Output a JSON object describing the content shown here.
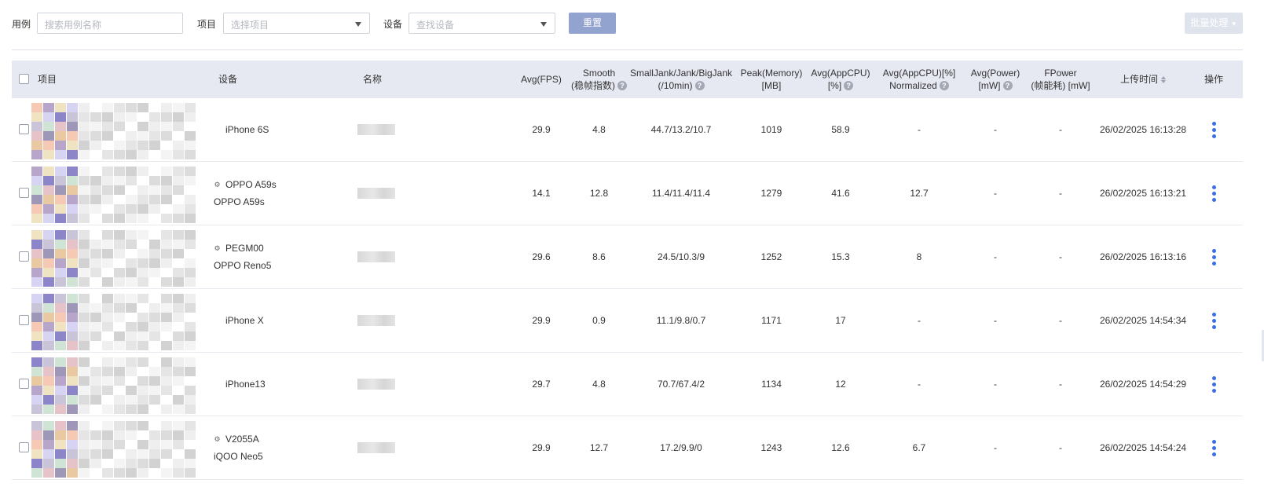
{
  "filters": {
    "case_label": "用例",
    "case_placeholder": "搜索用例名称",
    "project_label": "项目",
    "project_placeholder": "选择项目",
    "device_label": "设备",
    "device_placeholder": "查找设备",
    "reset_label": "重置",
    "batch_label": "批量处理"
  },
  "columns": {
    "project": "项目",
    "device": "设备",
    "name": "名称",
    "fps": "Avg(FPS)",
    "smooth_1": "Smooth",
    "smooth_2": "(稳帧指数)",
    "jank_1": "SmallJank/Jank/BigJank",
    "jank_2": "(/10min)",
    "memory_1": "Peak(Memory)",
    "memory_2": "[MB]",
    "cpu_1": "Avg(AppCPU)",
    "cpu_2": "[%]",
    "cpun_1": "Avg(AppCPU)[%]",
    "cpun_2": "Normalized",
    "power_1": "Avg(Power)",
    "power_2": "[mW]",
    "fpower_1": "FPower",
    "fpower_2": "(帧能耗) [mW]",
    "upload_time": "上传时间",
    "actions": "操作"
  },
  "rows": [
    {
      "os": "apple-icon",
      "device_line1": "iPhone 6S",
      "device_line2": "",
      "fps": "29.9",
      "smooth": "4.8",
      "jank": "44.7/13.2/10.7",
      "memory": "1019",
      "cpu": "58.9",
      "cpu_norm": "-",
      "power": "-",
      "fpower": "-",
      "time": "26/02/2025 16:13:28"
    },
    {
      "os": "android-icon",
      "device_line1": "OPPO A59s",
      "device_line2": "OPPO A59s",
      "fps": "14.1",
      "smooth": "12.8",
      "jank": "11.4/11.4/11.4",
      "memory": "1279",
      "cpu": "41.6",
      "cpu_norm": "12.7",
      "power": "-",
      "fpower": "-",
      "time": "26/02/2025 16:13:21"
    },
    {
      "os": "android-icon",
      "device_line1": "PEGM00",
      "device_line2": "OPPO Reno5",
      "fps": "29.6",
      "smooth": "8.6",
      "jank": "24.5/10.3/9",
      "memory": "1252",
      "cpu": "15.3",
      "cpu_norm": "8",
      "power": "-",
      "fpower": "-",
      "time": "26/02/2025 16:13:16"
    },
    {
      "os": "apple-icon",
      "device_line1": "iPhone X",
      "device_line2": "",
      "fps": "29.9",
      "smooth": "0.9",
      "jank": "11.1/9.8/0.7",
      "memory": "1171",
      "cpu": "17",
      "cpu_norm": "-",
      "power": "-",
      "fpower": "-",
      "time": "26/02/2025 14:54:34"
    },
    {
      "os": "apple-icon",
      "device_line1": "iPhone13",
      "device_line2": "",
      "fps": "29.7",
      "smooth": "4.8",
      "jank": "70.7/67.4/2",
      "memory": "1134",
      "cpu": "12",
      "cpu_norm": "-",
      "power": "-",
      "fpower": "-",
      "time": "26/02/2025 14:54:29"
    },
    {
      "os": "android-icon",
      "device_line1": "V2055A",
      "device_line2": "iQOO Neo5",
      "fps": "29.9",
      "smooth": "12.7",
      "jank": "17.2/9.9/0",
      "memory": "1243",
      "cpu": "12.6",
      "cpu_norm": "6.7",
      "power": "-",
      "fpower": "-",
      "time": "26/02/2025 14:54:24"
    }
  ],
  "colors": {
    "accent": "#3b6de6",
    "header_bg": "#e6e9f2",
    "reset_bg": "#93a3cf"
  }
}
